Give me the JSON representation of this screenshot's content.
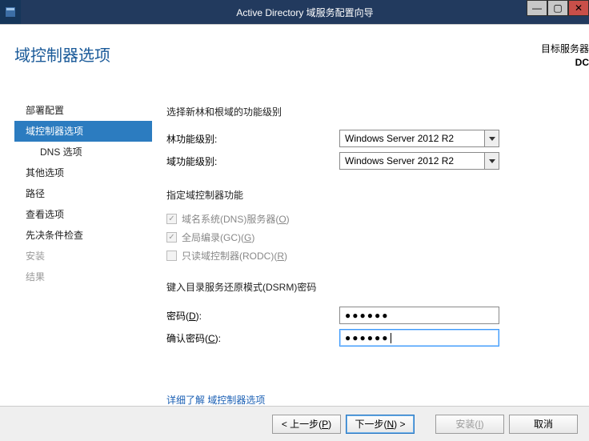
{
  "window": {
    "title": "Active Directory 域服务配置向导"
  },
  "header": {
    "page_title": "域控制器选项",
    "target_label": "目标服务器",
    "target_value": "DC"
  },
  "sidebar": {
    "items": [
      {
        "label": "部署配置",
        "state": "normal"
      },
      {
        "label": "域控制器选项",
        "state": "selected"
      },
      {
        "label": "DNS 选项",
        "state": "sub"
      },
      {
        "label": "其他选项",
        "state": "normal"
      },
      {
        "label": "路径",
        "state": "normal"
      },
      {
        "label": "查看选项",
        "state": "normal"
      },
      {
        "label": "先决条件检查",
        "state": "normal"
      },
      {
        "label": "安装",
        "state": "disabled"
      },
      {
        "label": "结果",
        "state": "disabled"
      }
    ]
  },
  "main": {
    "section1_title": "选择新林和根域的功能级别",
    "forest_label": "林功能级别:",
    "forest_value": "Windows Server 2012 R2",
    "domain_label": "域功能级别:",
    "domain_value": "Windows Server 2012 R2",
    "section2_title": "指定域控制器功能",
    "dns_label_pre": "域名系统(DNS)服务器(",
    "dns_key": "O",
    "dns_label_post": ")",
    "dns_checked": true,
    "dns_disabled": true,
    "gc_label_pre": "全局编录(GC)(",
    "gc_key": "G",
    "gc_label_post": ")",
    "gc_checked": true,
    "gc_disabled": true,
    "rodc_label_pre": "只读域控制器(RODC)(",
    "rodc_key": "R",
    "rodc_label_post": ")",
    "rodc_checked": false,
    "rodc_disabled": true,
    "section3_title": "键入目录服务还原模式(DSRM)密码",
    "pw_label_pre": "密码(",
    "pw_key": "D",
    "pw_label_post": "):",
    "pw_value": "●●●●●●",
    "cpw_label_pre": "确认密码(",
    "cpw_key": "C",
    "cpw_label_post": "):",
    "cpw_value": "●●●●●●",
    "link_text": "详细了解 域控制器选项"
  },
  "footer": {
    "prev_pre": "< 上一步(",
    "prev_key": "P",
    "prev_post": ")",
    "next_pre": "下一步(",
    "next_key": "N",
    "next_post": ") >",
    "install_pre": "安装(",
    "install_key": "I",
    "install_post": ")",
    "cancel": "取消"
  }
}
